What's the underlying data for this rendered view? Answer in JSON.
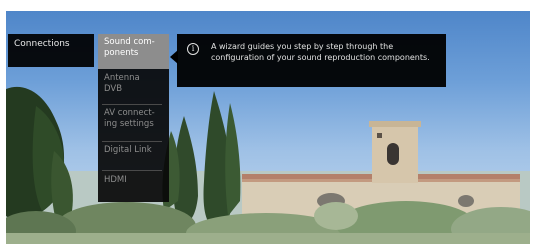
{
  "menu": {
    "connections_label": "Connections"
  },
  "submenu": {
    "items": [
      {
        "label": "Sound com-\nponents",
        "selected": true
      },
      {
        "label": "Antenna\nDVB",
        "selected": false
      },
      {
        "label": "AV connect-\ning settings",
        "selected": false
      },
      {
        "label": "Digital Link",
        "selected": false
      },
      {
        "label": "HDMI",
        "selected": false
      }
    ]
  },
  "tooltip": {
    "icon": "info-icon",
    "text": "A wizard guides you step by step through the configuration of your sound reproduction components."
  },
  "colors": {
    "menu_bg": "#0a0a0a",
    "selected_bg": "#8d8d8d",
    "item_text": "#8d8d8d",
    "selected_text": "#ffffff"
  }
}
